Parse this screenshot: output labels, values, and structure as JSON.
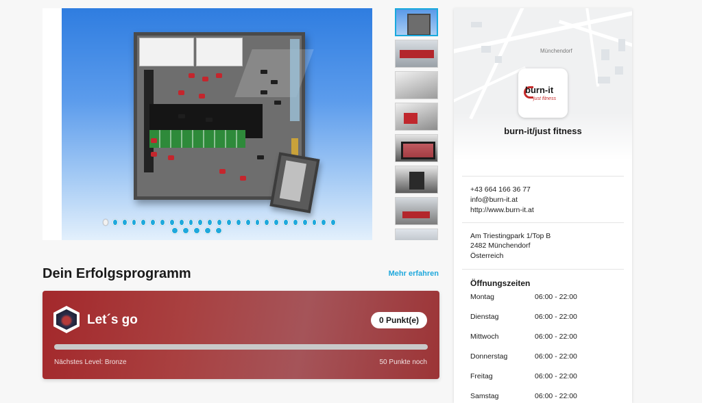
{
  "gallery": {
    "slide_count": 30,
    "active_slide": 1,
    "thumbnail_count": 8
  },
  "program": {
    "title": "Dein Erfolgsprogramm",
    "more_link": "Mehr erfahren",
    "level_name": "Let´s go",
    "points_badge": "0 Punkt(e)",
    "progress_fraction": 0,
    "next_level": "Nächstes Level: Bronze",
    "remaining": "50 Punkte noch"
  },
  "gym": {
    "map_label": "Münchendorf",
    "logo_text": "burn-it",
    "logo_subtext": "just fitness",
    "name": "burn-it/just fitness",
    "phone": "+43 664 166 36 77",
    "email": "info@burn-it.at",
    "website": "http://www.burn-it.at",
    "address_line1": "Am Triestingpark 1/Top B",
    "address_line2": "2482 Münchendorf",
    "country": "Österreich"
  },
  "hours": {
    "title": "Öffnungszeiten",
    "rows": [
      {
        "day": "Montag",
        "time": "06:00 - 22:00"
      },
      {
        "day": "Dienstag",
        "time": "06:00 - 22:00"
      },
      {
        "day": "Mittwoch",
        "time": "06:00 - 22:00"
      },
      {
        "day": "Donnerstag",
        "time": "06:00 - 22:00"
      },
      {
        "day": "Freitag",
        "time": "06:00 - 22:00"
      },
      {
        "day": "Samstag",
        "time": "06:00 - 22:00"
      }
    ]
  },
  "colors": {
    "accent": "#1fa8dc",
    "program_card": "#a3282b",
    "brand_red": "#c62b2b"
  }
}
